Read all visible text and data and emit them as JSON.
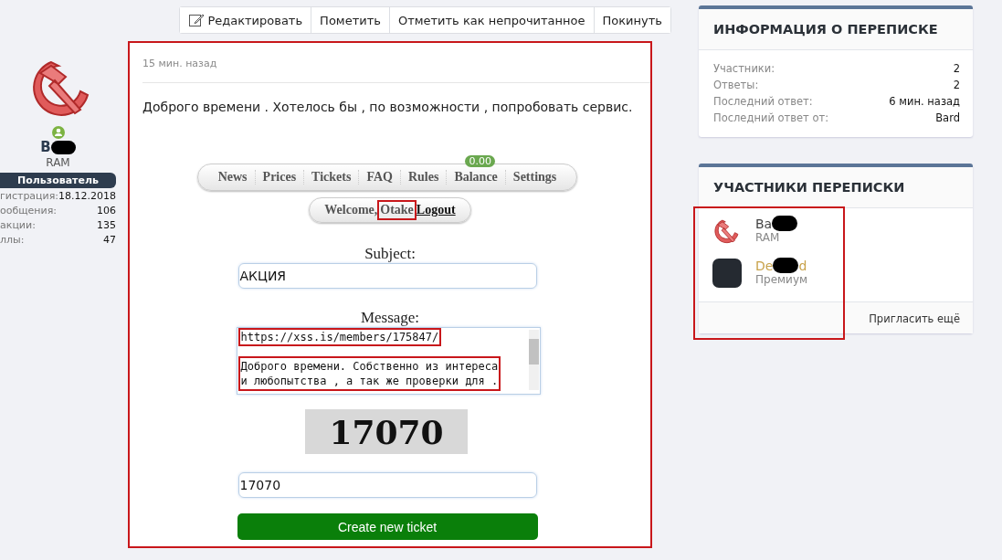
{
  "toolbar": {
    "buttons": [
      {
        "label": "Редактировать",
        "kind": "edit"
      },
      {
        "label": "Пометить",
        "kind": "plain"
      },
      {
        "label": "Отметить как непрочитанное",
        "kind": "plain"
      },
      {
        "label": "Покинуть",
        "kind": "plain"
      }
    ]
  },
  "author": {
    "name": "B",
    "role": "RAM",
    "badge": "Пользователь",
    "online": true,
    "stats": [
      {
        "label": "гистрация:",
        "value": "18.12.2018"
      },
      {
        "label": "ообщения:",
        "value": "106"
      },
      {
        "label": "акции:",
        "value": "135"
      },
      {
        "label": "ллы:",
        "value": "47"
      }
    ]
  },
  "post": {
    "time": "15 мин. назад",
    "text": "Доброго времени . Хотелось бы , по возможности , попробовать сервис.",
    "highlighted": true,
    "embedded_screenshot": {
      "nav": [
        {
          "label": "News"
        },
        {
          "label": "Prices"
        },
        {
          "label": "Tickets"
        },
        {
          "label": "FAQ"
        },
        {
          "label": "Rules"
        },
        {
          "label": "Balance",
          "badge": "0.00"
        },
        {
          "label": "Settings"
        }
      ],
      "welcome": "Welcome,",
      "username": "Otake",
      "username_highlighted": true,
      "logout": "Logout",
      "subject_label": "Subject:",
      "subject_value": "АКЦИЯ",
      "message_label": "Message:",
      "message_url": "https://xss.is/members/175847/",
      "url_highlighted": true,
      "message_lines": [
        "Доброго времени. Собственно из интереса",
        "и любопытства , а так же проверки для ."
      ],
      "message_highlighted": true,
      "captcha": "17070",
      "captcha_value": "17070",
      "submit": "Create new ticket"
    }
  },
  "info": {
    "title": "ИНФОРМАЦИЯ О ПЕРЕПИСКЕ",
    "rows": [
      {
        "label": "Участники:",
        "value": "2"
      },
      {
        "label": "Ответы:",
        "value": "2"
      },
      {
        "label": "Последний ответ:",
        "value": "6 мин. назад"
      },
      {
        "label": "Последний ответ от:",
        "value": "Bard"
      }
    ]
  },
  "participants": {
    "title": "УЧАСТНИКИ ПЕРЕПИСКИ",
    "highlighted": true,
    "items": [
      {
        "name_start": "Ba",
        "role": "RAM",
        "kind": "symbol",
        "premium": false
      },
      {
        "name_start": "De",
        "name_end": "d",
        "role": "Премиум",
        "kind": "placeholder",
        "premium": true
      }
    ],
    "invite": "Пригласить ещё"
  }
}
